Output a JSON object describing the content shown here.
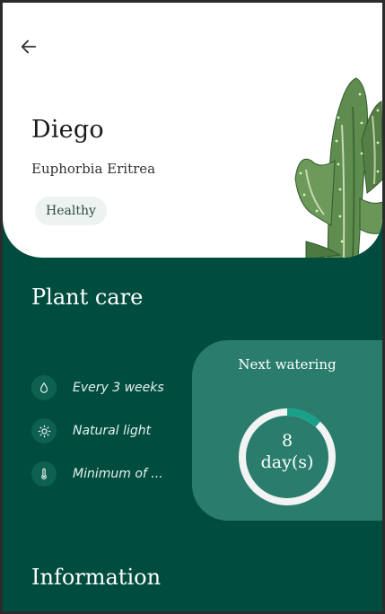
{
  "plant": {
    "name": "Diego",
    "species": "Euphorbia Eritrea",
    "status": "Healthy"
  },
  "plant_care": {
    "title": "Plant care",
    "items": [
      {
        "icon": "water-drop-icon",
        "text": "Every 3 weeks"
      },
      {
        "icon": "sun-icon",
        "text": "Natural light"
      },
      {
        "icon": "thermometer-icon",
        "text": "Minimum of ..."
      }
    ]
  },
  "watering": {
    "title": "Next watering",
    "value": "8",
    "unit": "day(s)",
    "progress_fraction": 0.12
  },
  "information": {
    "title": "Information"
  },
  "colors": {
    "primary_dark": "#004d40",
    "card": "#2a7d6d",
    "ring_track": "#f2f4f3",
    "ring_progress": "#17a08a",
    "chip_bg": "#edf3f1"
  }
}
